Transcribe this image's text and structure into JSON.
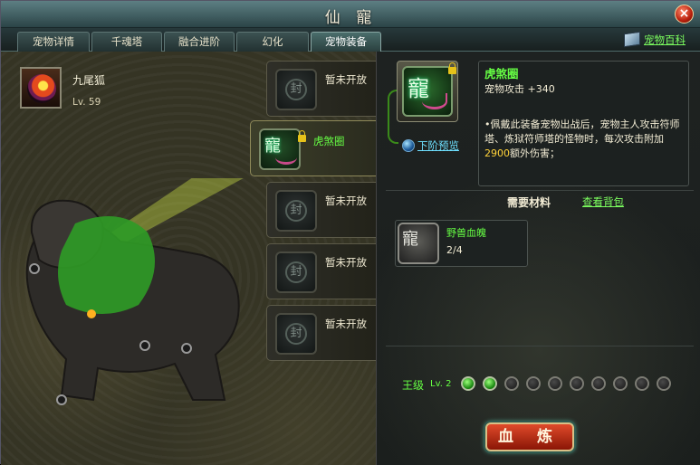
{
  "window": {
    "title": "仙 寵"
  },
  "tabs": [
    {
      "label": "宠物详情",
      "active": false
    },
    {
      "label": "千魂塔",
      "active": false
    },
    {
      "label": "融合进阶",
      "active": false
    },
    {
      "label": "幻化",
      "active": false
    },
    {
      "label": "宠物装备",
      "active": true
    }
  ],
  "encyclopedia_link": "宠物百科",
  "pet": {
    "name": "九尾狐",
    "level": "Lv. 59"
  },
  "slots": [
    {
      "label": "暂未开放",
      "state": "locked"
    },
    {
      "label": "虎煞圈",
      "state": "equipped"
    },
    {
      "label": "暂未开放",
      "state": "locked"
    },
    {
      "label": "暂未开放",
      "state": "locked"
    },
    {
      "label": "暂未开放",
      "state": "locked"
    }
  ],
  "seal_glyph": "封",
  "equip_glyph": "寵",
  "equipment": {
    "name": "虎煞圈",
    "stat": "宠物攻击 +340",
    "desc_before": "•佩戴此装备宠物出战后，宠物主人攻击符师塔、炼狱符师塔的怪物时，每次攻击附加",
    "desc_num": "2900",
    "desc_after": "额外伤害；",
    "next_preview": "下阶预览"
  },
  "materials": {
    "title": "需要材料",
    "bag_link": "查看背包",
    "items": [
      {
        "name": "野兽血魄",
        "count": "2/4"
      }
    ]
  },
  "level": {
    "label": "王级",
    "value": "Lv. 2",
    "filled": 2,
    "total": 10
  },
  "refine_button": "血 炼",
  "colors": {
    "accent_green": "#66ff44",
    "highlight_yellow": "#ffd23a",
    "link_cyan": "#6ee0ff"
  }
}
